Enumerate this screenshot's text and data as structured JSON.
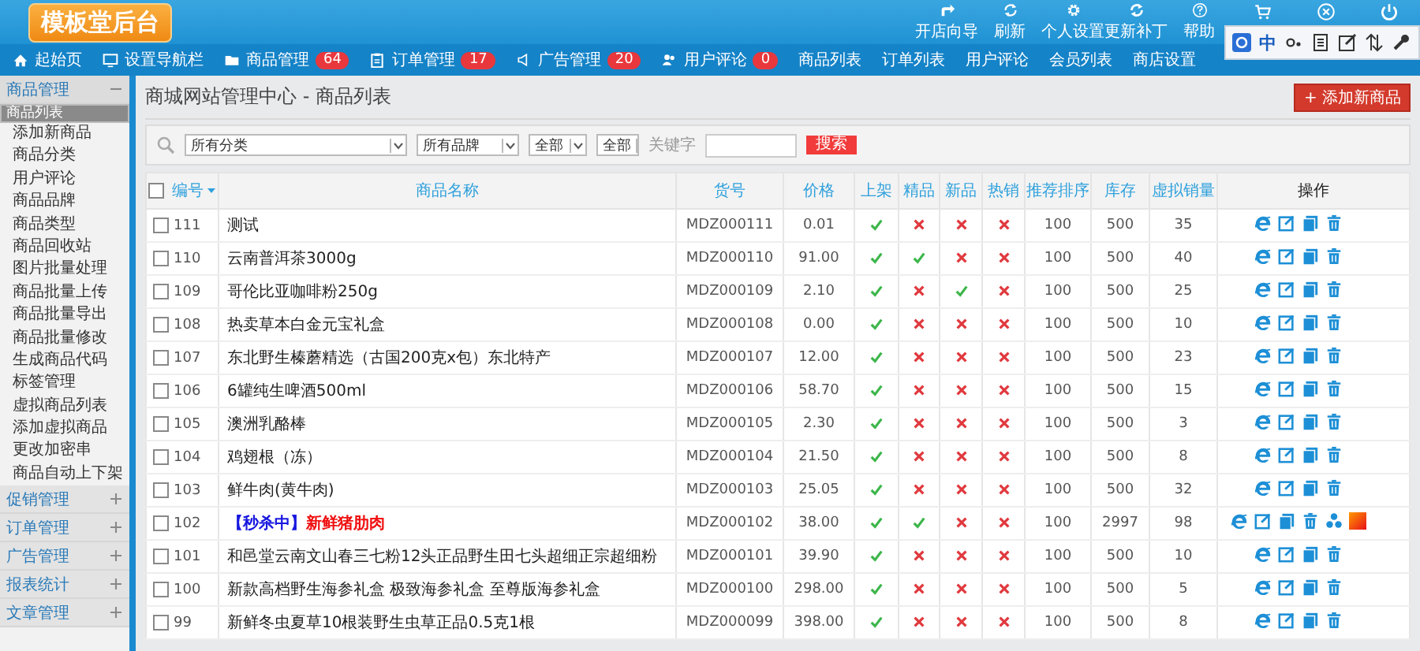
{
  "logo": "模板堂后台",
  "top_buttons": [
    {
      "kind": "guide",
      "label": "开店向导"
    },
    {
      "kind": "refresh",
      "label": "刷新"
    },
    {
      "kind": "gear",
      "label": "个人设置"
    },
    {
      "kind": "update",
      "label": "更新补丁"
    },
    {
      "kind": "help",
      "label": "帮助"
    },
    {
      "kind": "cart"
    },
    {
      "kind": "clear"
    },
    {
      "kind": "power"
    }
  ],
  "ime_toolbar": {
    "mode": "中"
  },
  "nav": [
    {
      "kind": "home",
      "label": "起始页"
    },
    {
      "kind": "screen",
      "label": "设置导航栏"
    },
    {
      "kind": "folder",
      "label": "商品管理",
      "badge": "64"
    },
    {
      "kind": "clipboard",
      "label": "订单管理",
      "badge": "17"
    },
    {
      "kind": "speaker",
      "label": "广告管理",
      "badge": "20"
    },
    {
      "kind": "users",
      "label": "用户评论",
      "badge": "0"
    },
    {
      "label": "商品列表"
    },
    {
      "label": "订单列表"
    },
    {
      "label": "用户评论"
    },
    {
      "label": "会员列表"
    },
    {
      "label": "商店设置"
    }
  ],
  "sidebar": {
    "groups": [
      {
        "title": "商品管理",
        "expanded": true,
        "items": [
          {
            "label": "商品列表",
            "selected": true
          },
          {
            "label": "添加新商品",
            "selected": false
          },
          {
            "label": "商品分类",
            "selected": false
          },
          {
            "label": "用户评论",
            "selected": false
          },
          {
            "label": "商品品牌",
            "selected": false
          },
          {
            "label": "商品类型",
            "selected": false
          },
          {
            "label": "商品回收站",
            "selected": false
          },
          {
            "label": "图片批量处理",
            "selected": false
          },
          {
            "label": "商品批量上传",
            "selected": false
          },
          {
            "label": "商品批量导出",
            "selected": false
          },
          {
            "label": "商品批量修改",
            "selected": false
          },
          {
            "label": "生成商品代码",
            "selected": false
          },
          {
            "label": "标签管理",
            "selected": false
          },
          {
            "label": "虚拟商品列表",
            "selected": false
          },
          {
            "label": "添加虚拟商品",
            "selected": false
          },
          {
            "label": "更改加密串",
            "selected": false
          },
          {
            "label": "商品自动上下架",
            "selected": false
          }
        ]
      },
      {
        "title": "促销管理",
        "expanded": false
      },
      {
        "title": "订单管理",
        "expanded": false
      },
      {
        "title": "广告管理",
        "expanded": false
      },
      {
        "title": "报表统计",
        "expanded": false
      },
      {
        "title": "文章管理",
        "expanded": false
      }
    ]
  },
  "page_title": "商城网站管理中心 - 商品列表",
  "add_button": "+ 添加新商品",
  "filters": {
    "selects": [
      "所有分类",
      "所有品牌",
      "全部",
      "全部"
    ],
    "keyword_label": "关键字",
    "search_button": "搜索"
  },
  "table": {
    "select_all_checked": false,
    "columns": [
      "编号",
      "商品名称",
      "货号",
      "价格",
      "上架",
      "精品",
      "新品",
      "热销",
      "推荐排序",
      "库存",
      "虚拟销量",
      "操作"
    ],
    "rows": [
      {
        "id": "111",
        "checked": false,
        "name": "测试",
        "sku": "MDZ000111",
        "price": "0.01",
        "on_sale": true,
        "best": false,
        "new": false,
        "hot": false,
        "sort": "100",
        "stock": "500",
        "virtual_sales": "35",
        "actions": [
          {
            "kind": "view"
          },
          {
            "kind": "edit"
          },
          {
            "kind": "copy"
          },
          {
            "kind": "delete"
          }
        ]
      },
      {
        "id": "110",
        "checked": false,
        "name": "云南普洱茶3000g",
        "sku": "MDZ000110",
        "price": "91.00",
        "on_sale": true,
        "best": true,
        "new": false,
        "hot": false,
        "sort": "100",
        "stock": "500",
        "virtual_sales": "40",
        "actions": [
          {
            "kind": "view"
          },
          {
            "kind": "edit"
          },
          {
            "kind": "copy"
          },
          {
            "kind": "delete"
          }
        ]
      },
      {
        "id": "109",
        "checked": false,
        "name": "哥伦比亚咖啡粉250g",
        "sku": "MDZ000109",
        "price": "2.10",
        "on_sale": true,
        "best": false,
        "new": true,
        "hot": false,
        "sort": "100",
        "stock": "500",
        "virtual_sales": "25",
        "actions": [
          {
            "kind": "view"
          },
          {
            "kind": "edit"
          },
          {
            "kind": "copy"
          },
          {
            "kind": "delete"
          }
        ]
      },
      {
        "id": "108",
        "checked": false,
        "name": "热卖草本白金元宝礼盒",
        "sku": "MDZ000108",
        "price": "0.00",
        "on_sale": true,
        "best": false,
        "new": false,
        "hot": false,
        "sort": "100",
        "stock": "500",
        "virtual_sales": "10",
        "actions": [
          {
            "kind": "view"
          },
          {
            "kind": "edit"
          },
          {
            "kind": "copy"
          },
          {
            "kind": "delete"
          }
        ]
      },
      {
        "id": "107",
        "checked": false,
        "name": "东北野生榛蘑精选（古国200克x包）东北特产",
        "sku": "MDZ000107",
        "price": "12.00",
        "on_sale": true,
        "best": false,
        "new": false,
        "hot": false,
        "sort": "100",
        "stock": "500",
        "virtual_sales": "23",
        "actions": [
          {
            "kind": "view"
          },
          {
            "kind": "edit"
          },
          {
            "kind": "copy"
          },
          {
            "kind": "delete"
          }
        ]
      },
      {
        "id": "106",
        "checked": false,
        "name": "6罐纯生啤酒500ml",
        "sku": "MDZ000106",
        "price": "58.70",
        "on_sale": true,
        "best": false,
        "new": false,
        "hot": false,
        "sort": "100",
        "stock": "500",
        "virtual_sales": "15",
        "actions": [
          {
            "kind": "view"
          },
          {
            "kind": "edit"
          },
          {
            "kind": "copy"
          },
          {
            "kind": "delete"
          }
        ]
      },
      {
        "id": "105",
        "checked": false,
        "name": "澳洲乳酪棒",
        "sku": "MDZ000105",
        "price": "2.30",
        "on_sale": true,
        "best": false,
        "new": false,
        "hot": false,
        "sort": "100",
        "stock": "500",
        "virtual_sales": "3",
        "actions": [
          {
            "kind": "view"
          },
          {
            "kind": "edit"
          },
          {
            "kind": "copy"
          },
          {
            "kind": "delete"
          }
        ]
      },
      {
        "id": "104",
        "checked": false,
        "name": "鸡翅根（冻）",
        "sku": "MDZ000104",
        "price": "21.50",
        "on_sale": true,
        "best": false,
        "new": false,
        "hot": false,
        "sort": "100",
        "stock": "500",
        "virtual_sales": "8",
        "actions": [
          {
            "kind": "view"
          },
          {
            "kind": "edit"
          },
          {
            "kind": "copy"
          },
          {
            "kind": "delete"
          }
        ]
      },
      {
        "id": "103",
        "checked": false,
        "name": "鲜牛肉(黄牛肉)",
        "sku": "MDZ000103",
        "price": "25.05",
        "on_sale": true,
        "best": false,
        "new": false,
        "hot": false,
        "sort": "100",
        "stock": "500",
        "virtual_sales": "32",
        "actions": [
          {
            "kind": "view"
          },
          {
            "kind": "edit"
          },
          {
            "kind": "copy"
          },
          {
            "kind": "delete"
          }
        ]
      },
      {
        "id": "102",
        "checked": false,
        "tag": "【秒杀中】",
        "name": "新鲜猪肋肉",
        "sku": "MDZ000102",
        "price": "38.00",
        "on_sale": true,
        "best": true,
        "new": false,
        "hot": false,
        "sort": "100",
        "stock": "2997",
        "virtual_sales": "98",
        "actions": [
          {
            "kind": "view"
          },
          {
            "kind": "edit"
          },
          {
            "kind": "copy"
          },
          {
            "kind": "delete"
          },
          {
            "kind": "share"
          },
          {
            "kind": "color"
          }
        ]
      },
      {
        "id": "101",
        "checked": false,
        "name": "和邑堂云南文山春三七粉12头正品野生田七头超细正宗超细粉",
        "sku": "MDZ000101",
        "price": "39.90",
        "on_sale": true,
        "best": false,
        "new": false,
        "hot": false,
        "sort": "100",
        "stock": "500",
        "virtual_sales": "10",
        "actions": [
          {
            "kind": "view"
          },
          {
            "kind": "edit"
          },
          {
            "kind": "copy"
          },
          {
            "kind": "delete"
          }
        ]
      },
      {
        "id": "100",
        "checked": false,
        "name": "新款高档野生海参礼盒 极致海参礼盒 至尊版海参礼盒",
        "sku": "MDZ000100",
        "price": "298.00",
        "on_sale": true,
        "best": false,
        "new": false,
        "hot": false,
        "sort": "100",
        "stock": "500",
        "virtual_sales": "5",
        "actions": [
          {
            "kind": "view"
          },
          {
            "kind": "edit"
          },
          {
            "kind": "copy"
          },
          {
            "kind": "delete"
          }
        ]
      },
      {
        "id": "99",
        "checked": false,
        "name": "新鲜冬虫夏草10根装野生虫草正品0.5克1根",
        "sku": "MDZ000099",
        "price": "398.00",
        "on_sale": true,
        "best": false,
        "new": false,
        "hot": false,
        "sort": "100",
        "stock": "500",
        "virtual_sales": "8",
        "actions": [
          {
            "kind": "view"
          },
          {
            "kind": "edit"
          },
          {
            "kind": "copy"
          },
          {
            "kind": "delete"
          }
        ]
      }
    ]
  }
}
